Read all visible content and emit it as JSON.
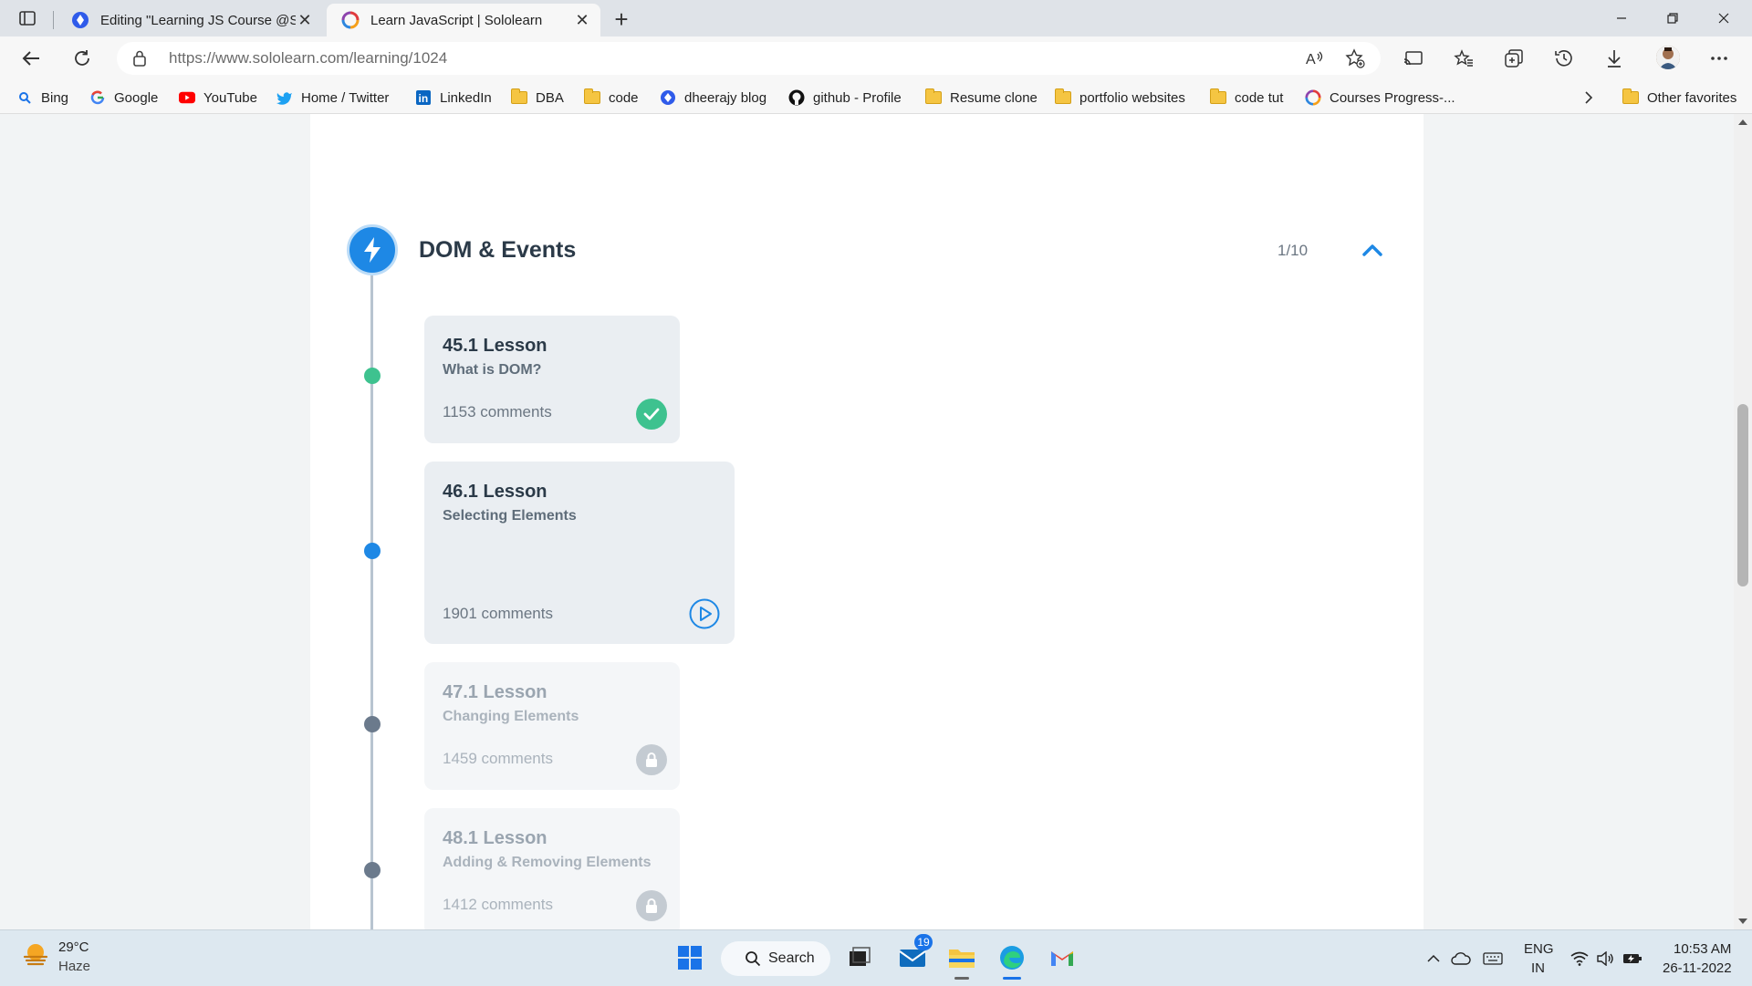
{
  "browser": {
    "tabs": [
      {
        "title": "Editing \"Learning JS Course @Sc",
        "active": false
      },
      {
        "title": "Learn JavaScript | Sololearn",
        "active": true
      }
    ],
    "url_host": "https://www.sololearn.com",
    "url_path": "/learning/1024",
    "bookmarks": [
      {
        "label": "Bing",
        "icon": "bing-icon"
      },
      {
        "label": "Google",
        "icon": "google-icon"
      },
      {
        "label": "YouTube",
        "icon": "youtube-icon"
      },
      {
        "label": "Home / Twitter",
        "icon": "twitter-icon"
      },
      {
        "label": "LinkedIn",
        "icon": "linkedin-icon"
      },
      {
        "label": "DBA",
        "icon": "folder-icon"
      },
      {
        "label": "code",
        "icon": "folder-icon"
      },
      {
        "label": "dheerajy blog",
        "icon": "blog-icon"
      },
      {
        "label": "github - Profile",
        "icon": "github-icon"
      },
      {
        "label": "Resume clone",
        "icon": "folder-icon"
      },
      {
        "label": "portfolio websites",
        "icon": "folder-icon"
      },
      {
        "label": "code tut",
        "icon": "folder-icon"
      },
      {
        "label": "Courses Progress-...",
        "icon": "sololearn-icon"
      }
    ],
    "other_favorites": "Other favorites"
  },
  "module": {
    "title": "DOM & Events",
    "progress": "1/10",
    "lessons": [
      {
        "title": "45.1 Lesson",
        "subtitle": "What is DOM?",
        "comments": "1153 comments",
        "status": "completed"
      },
      {
        "title": "46.1 Lesson",
        "subtitle": "Selecting Elements",
        "comments": "1901 comments",
        "status": "current"
      },
      {
        "title": "47.1 Lesson",
        "subtitle": "Changing Elements",
        "comments": "1459 comments",
        "status": "locked"
      },
      {
        "title": "48.1 Lesson",
        "subtitle": "Adding & Removing Elements",
        "comments": "1412 comments",
        "status": "locked"
      }
    ]
  },
  "colors": {
    "completed": "#3ec28f",
    "current": "#1e88e5",
    "locked": "#6b7a8c",
    "module_icon": "#1e88e5"
  },
  "taskbar": {
    "weather_temp": "29°C",
    "weather_desc": "Haze",
    "search_label": "Search",
    "mail_badge": "19",
    "lang_line1": "ENG",
    "lang_line2": "IN",
    "time": "10:53 AM",
    "date": "26-11-2022"
  }
}
